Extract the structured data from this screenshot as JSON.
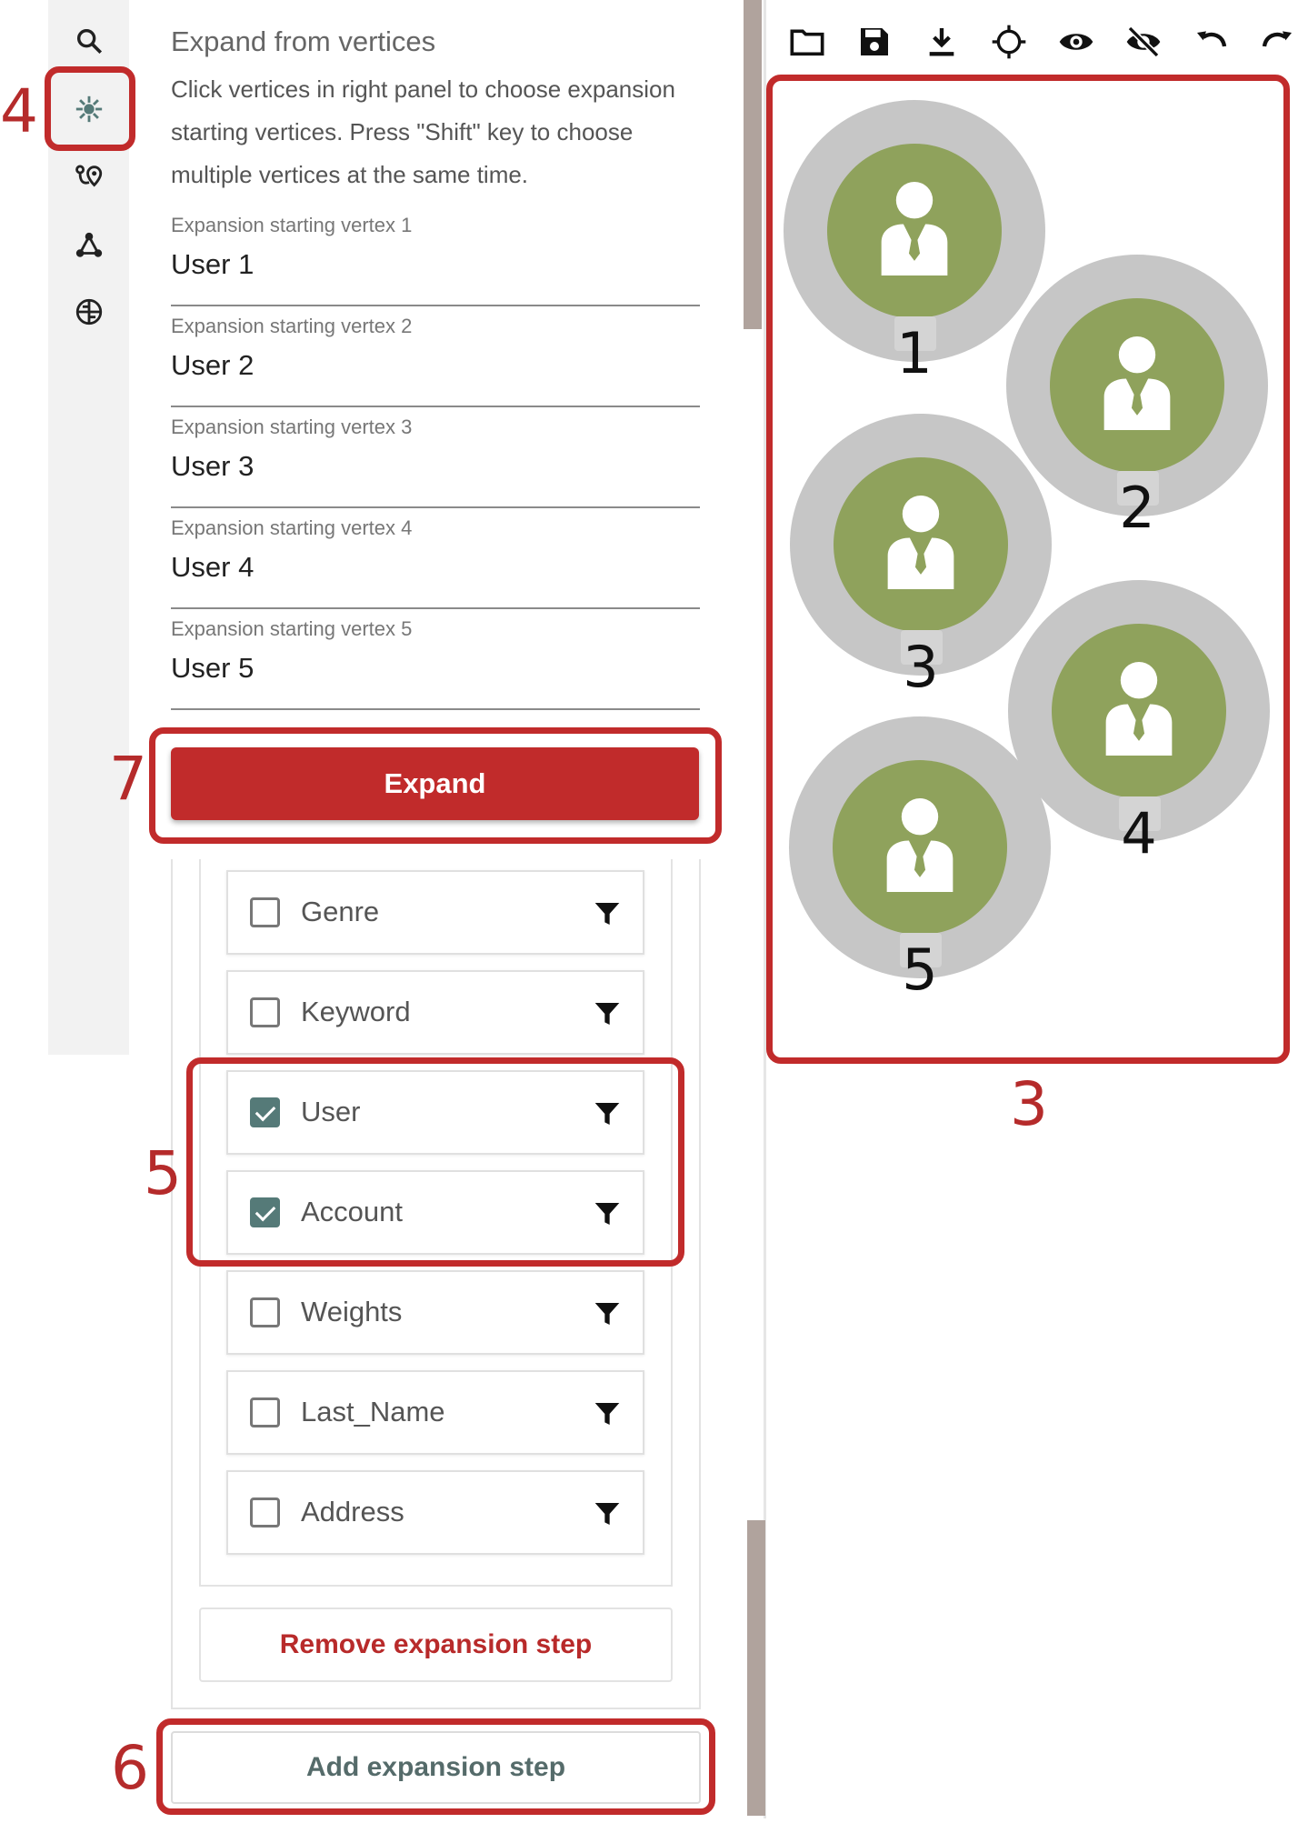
{
  "panel": {
    "title": "Expand from vertices",
    "description": "Click vertices in right panel to choose expansion starting vertices. Press \"Shift\" key to choose multiple vertices at the same time.",
    "fields": [
      {
        "label": "Expansion starting vertex 1",
        "value": "User 1"
      },
      {
        "label": "Expansion starting vertex 2",
        "value": "User 2"
      },
      {
        "label": "Expansion starting vertex 3",
        "value": "User 3"
      },
      {
        "label": "Expansion starting vertex 4",
        "value": "User 4"
      },
      {
        "label": "Expansion starting vertex 5",
        "value": "User 5"
      }
    ],
    "expand_label": "Expand",
    "vertex_types": [
      {
        "name": "Genre",
        "checked": false
      },
      {
        "name": "Keyword",
        "checked": false
      },
      {
        "name": "User",
        "checked": true
      },
      {
        "name": "Account",
        "checked": true
      },
      {
        "name": "Weights",
        "checked": false
      },
      {
        "name": "Last_Name",
        "checked": false
      },
      {
        "name": "Address",
        "checked": false
      }
    ],
    "remove_label": "Remove expansion step",
    "add_label": "Add expansion step"
  },
  "rail_icons": [
    "search-icon",
    "expand-icon",
    "path-icon",
    "graph-icon",
    "globe-icon"
  ],
  "toolbar_icons": [
    "folder-icon",
    "save-icon",
    "download-icon",
    "locate-icon",
    "eye-icon",
    "eye-off-icon",
    "undo-icon",
    "redo-icon"
  ],
  "graph": {
    "vertices": [
      {
        "label": "1",
        "type": "user-icon"
      },
      {
        "label": "2",
        "type": "user-icon"
      },
      {
        "label": "3",
        "type": "user-icon"
      },
      {
        "label": "4",
        "type": "user-icon"
      },
      {
        "label": "5",
        "type": "user-icon"
      }
    ]
  },
  "annotations": {
    "a3": "3",
    "a4": "4",
    "a5": "5",
    "a6": "6",
    "a7": "7"
  },
  "colors": {
    "accent": "#c12b2b",
    "vertex_fill": "#8fa25c",
    "vertex_halo": "#c6c6c6",
    "checkbox": "#557a78"
  }
}
